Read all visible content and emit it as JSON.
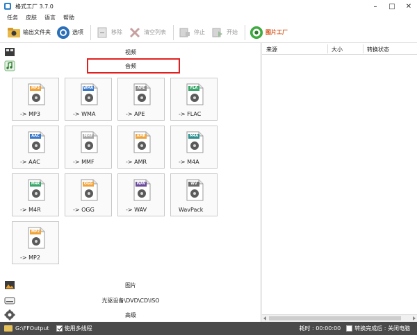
{
  "window": {
    "title": "格式工厂 3.7.0"
  },
  "menu": [
    "任务",
    "皮肤",
    "语言",
    "帮助"
  ],
  "toolbar": {
    "output_folder": "输出文件夹",
    "options": "选项",
    "remove": "移除",
    "clear_list": "清空列表",
    "stop": "停止",
    "start": "开始",
    "picture_factory": "图片工厂"
  },
  "categories": {
    "video": "视频",
    "audio": "音频",
    "picture": "图片",
    "disc": "光驱设备\\DVD\\CD\\ISO",
    "advanced": "高级"
  },
  "tiles": [
    {
      "badge": "MP3",
      "label": "-> MP3",
      "color": "#f0a33a"
    },
    {
      "badge": "WMA",
      "label": "-> WMA",
      "color": "#3a78c8"
    },
    {
      "badge": "APE",
      "label": "-> APE",
      "color": "#8a8a8a"
    },
    {
      "badge": "FLA",
      "label": "-> FLAC",
      "color": "#3aa66a"
    },
    {
      "badge": "AAC",
      "label": "-> AAC",
      "color": "#3a78c8"
    },
    {
      "badge": "MMF",
      "label": "-> MMF",
      "color": "#a7a7a7"
    },
    {
      "badge": "AMR",
      "label": "-> AMR",
      "color": "#f0a33a"
    },
    {
      "badge": "M4A",
      "label": "-> M4A",
      "color": "#2f8f8f"
    },
    {
      "badge": "M4R",
      "label": "-> M4R",
      "color": "#3aa66a"
    },
    {
      "badge": "OGG",
      "label": "-> OGG",
      "color": "#f0a33a"
    },
    {
      "badge": "WAV",
      "label": "-> WAV",
      "color": "#6a4a9a"
    },
    {
      "badge": "WV",
      "label": "WavPack",
      "color": "#6a6a6a"
    },
    {
      "badge": "MP2",
      "label": "-> MP2",
      "color": "#f0a33a"
    }
  ],
  "task_table": {
    "columns": [
      "来源",
      "大小",
      "转换状态"
    ]
  },
  "statusbar": {
    "output_path": "G:\\FFOutput",
    "multithread": "使用多线程",
    "elapsed": "耗时 : 00:00:00",
    "after_convert": "转换完成后 : 关闭电脑"
  }
}
